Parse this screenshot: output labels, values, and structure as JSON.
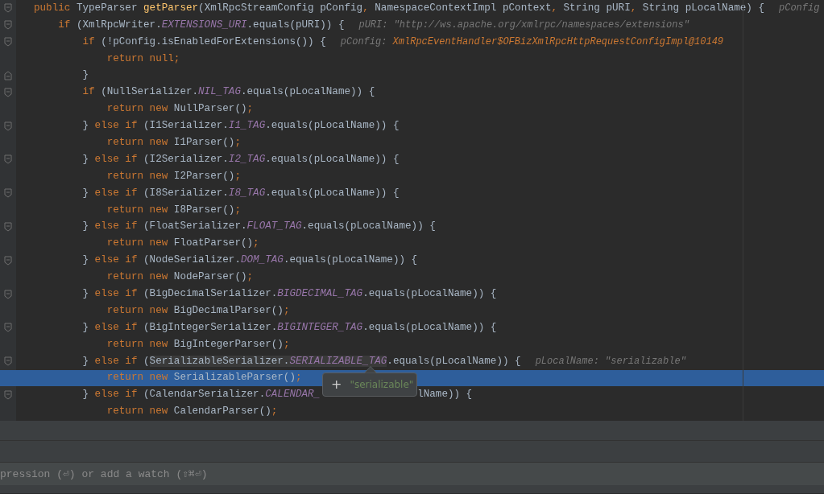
{
  "editor": {
    "lines": [
      {
        "fold_start": true,
        "fold_end": false,
        "selected": false,
        "segments": [
          {
            "kind": "keyword",
            "text": "public "
          },
          {
            "kind": "plain",
            "text": "TypeParser "
          },
          {
            "kind": "method",
            "text": "getParser"
          },
          {
            "kind": "plain",
            "text": "(XmlRpcStreamConfig pConfig"
          },
          {
            "kind": "keyword",
            "text": ", "
          },
          {
            "kind": "plain",
            "text": "NamespaceContextImpl pContext"
          },
          {
            "kind": "keyword",
            "text": ", "
          },
          {
            "kind": "plain",
            "text": "String pURI"
          },
          {
            "kind": "keyword",
            "text": ", "
          },
          {
            "kind": "plain",
            "text": "String pLocalName) {"
          }
        ],
        "hint": [
          {
            "kind": "hint",
            "text": "pConfig"
          }
        ]
      },
      {
        "fold_start": true,
        "fold_end": false,
        "selected": false,
        "segments": [
          {
            "kind": "keyword",
            "text": "    if "
          },
          {
            "kind": "plain",
            "text": "(XmlRpcWriter."
          },
          {
            "kind": "constant",
            "text": "EXTENSIONS_URI"
          },
          {
            "kind": "plain",
            "text": ".equals(pURI)) {"
          }
        ],
        "hint": [
          {
            "kind": "hint",
            "text": "pURI: \"http://ws.apache.org/xmlrpc/namespaces/extensions\""
          }
        ]
      },
      {
        "fold_start": true,
        "fold_end": false,
        "selected": false,
        "segments": [
          {
            "kind": "keyword",
            "text": "        if "
          },
          {
            "kind": "plain",
            "text": "(!pConfig.isEnabledForExtensions()) {"
          }
        ],
        "hint": [
          {
            "kind": "hint",
            "text": "pConfig: "
          },
          {
            "kind": "hint_value",
            "text": "XmlRpcEventHandler$OFBizXmlRpcHttpRequestConfigImpl@10149"
          }
        ]
      },
      {
        "fold_start": false,
        "fold_end": false,
        "selected": false,
        "segments": [
          {
            "kind": "keyword",
            "text": "            return null;"
          }
        ]
      },
      {
        "fold_start": false,
        "fold_end": true,
        "selected": false,
        "segments": [
          {
            "kind": "plain",
            "text": "        }"
          }
        ]
      },
      {
        "fold_start": true,
        "fold_end": false,
        "selected": false,
        "segments": [
          {
            "kind": "keyword",
            "text": "        if "
          },
          {
            "kind": "plain",
            "text": "(NullSerializer."
          },
          {
            "kind": "constant",
            "text": "NIL_TAG"
          },
          {
            "kind": "plain",
            "text": ".equals(pLocalName)) {"
          }
        ]
      },
      {
        "fold_start": false,
        "fold_end": false,
        "selected": false,
        "segments": [
          {
            "kind": "keyword",
            "text": "            return new "
          },
          {
            "kind": "plain",
            "text": "NullParser()"
          },
          {
            "kind": "keyword",
            "text": ";"
          }
        ]
      },
      {
        "fold_start": true,
        "fold_end": false,
        "selected": false,
        "segments": [
          {
            "kind": "plain",
            "text": "        } "
          },
          {
            "kind": "keyword",
            "text": "else if "
          },
          {
            "kind": "plain",
            "text": "(I1Serializer."
          },
          {
            "kind": "constant",
            "text": "I1_TAG"
          },
          {
            "kind": "plain",
            "text": ".equals(pLocalName)) {"
          }
        ]
      },
      {
        "fold_start": false,
        "fold_end": false,
        "selected": false,
        "segments": [
          {
            "kind": "keyword",
            "text": "            return new "
          },
          {
            "kind": "plain",
            "text": "I1Parser()"
          },
          {
            "kind": "keyword",
            "text": ";"
          }
        ]
      },
      {
        "fold_start": true,
        "fold_end": false,
        "selected": false,
        "segments": [
          {
            "kind": "plain",
            "text": "        } "
          },
          {
            "kind": "keyword",
            "text": "else if "
          },
          {
            "kind": "plain",
            "text": "(I2Serializer."
          },
          {
            "kind": "constant",
            "text": "I2_TAG"
          },
          {
            "kind": "plain",
            "text": ".equals(pLocalName)) {"
          }
        ]
      },
      {
        "fold_start": false,
        "fold_end": false,
        "selected": false,
        "segments": [
          {
            "kind": "keyword",
            "text": "            return new "
          },
          {
            "kind": "plain",
            "text": "I2Parser()"
          },
          {
            "kind": "keyword",
            "text": ";"
          }
        ]
      },
      {
        "fold_start": true,
        "fold_end": false,
        "selected": false,
        "segments": [
          {
            "kind": "plain",
            "text": "        } "
          },
          {
            "kind": "keyword",
            "text": "else if "
          },
          {
            "kind": "plain",
            "text": "(I8Serializer."
          },
          {
            "kind": "constant",
            "text": "I8_TAG"
          },
          {
            "kind": "plain",
            "text": ".equals(pLocalName)) {"
          }
        ]
      },
      {
        "fold_start": false,
        "fold_end": false,
        "selected": false,
        "segments": [
          {
            "kind": "keyword",
            "text": "            return new "
          },
          {
            "kind": "plain",
            "text": "I8Parser()"
          },
          {
            "kind": "keyword",
            "text": ";"
          }
        ]
      },
      {
        "fold_start": true,
        "fold_end": false,
        "selected": false,
        "segments": [
          {
            "kind": "plain",
            "text": "        } "
          },
          {
            "kind": "keyword",
            "text": "else if "
          },
          {
            "kind": "plain",
            "text": "(FloatSerializer."
          },
          {
            "kind": "constant",
            "text": "FLOAT_TAG"
          },
          {
            "kind": "plain",
            "text": ".equals(pLocalName)) {"
          }
        ]
      },
      {
        "fold_start": false,
        "fold_end": false,
        "selected": false,
        "segments": [
          {
            "kind": "keyword",
            "text": "            return new "
          },
          {
            "kind": "plain",
            "text": "FloatParser()"
          },
          {
            "kind": "keyword",
            "text": ";"
          }
        ]
      },
      {
        "fold_start": true,
        "fold_end": false,
        "selected": false,
        "segments": [
          {
            "kind": "plain",
            "text": "        } "
          },
          {
            "kind": "keyword",
            "text": "else if "
          },
          {
            "kind": "plain",
            "text": "(NodeSerializer."
          },
          {
            "kind": "constant",
            "text": "DOM_TAG"
          },
          {
            "kind": "plain",
            "text": ".equals(pLocalName)) {"
          }
        ]
      },
      {
        "fold_start": false,
        "fold_end": false,
        "selected": false,
        "segments": [
          {
            "kind": "keyword",
            "text": "            return new "
          },
          {
            "kind": "plain",
            "text": "NodeParser()"
          },
          {
            "kind": "keyword",
            "text": ";"
          }
        ]
      },
      {
        "fold_start": true,
        "fold_end": false,
        "selected": false,
        "segments": [
          {
            "kind": "plain",
            "text": "        } "
          },
          {
            "kind": "keyword",
            "text": "else if "
          },
          {
            "kind": "plain",
            "text": "(BigDecimalSerializer."
          },
          {
            "kind": "constant",
            "text": "BIGDECIMAL_TAG"
          },
          {
            "kind": "plain",
            "text": ".equals(pLocalName)) {"
          }
        ]
      },
      {
        "fold_start": false,
        "fold_end": false,
        "selected": false,
        "segments": [
          {
            "kind": "keyword",
            "text": "            return new "
          },
          {
            "kind": "plain",
            "text": "BigDecimalParser()"
          },
          {
            "kind": "keyword",
            "text": ";"
          }
        ]
      },
      {
        "fold_start": true,
        "fold_end": false,
        "selected": false,
        "segments": [
          {
            "kind": "plain",
            "text": "        } "
          },
          {
            "kind": "keyword",
            "text": "else if "
          },
          {
            "kind": "plain",
            "text": "(BigIntegerSerializer."
          },
          {
            "kind": "constant",
            "text": "BIGINTEGER_TAG"
          },
          {
            "kind": "plain",
            "text": ".equals(pLocalName)) {"
          }
        ]
      },
      {
        "fold_start": false,
        "fold_end": false,
        "selected": false,
        "segments": [
          {
            "kind": "keyword",
            "text": "            return new "
          },
          {
            "kind": "plain",
            "text": "BigIntegerParser()"
          },
          {
            "kind": "keyword",
            "text": ";"
          }
        ]
      },
      {
        "fold_start": true,
        "fold_end": false,
        "selected": false,
        "segments": [
          {
            "kind": "plain",
            "text": "        } "
          },
          {
            "kind": "keyword",
            "text": "else if "
          },
          {
            "kind": "plain",
            "text": "("
          },
          {
            "kind": "plain",
            "text": "SerializableSerializer.",
            "highlighted": true
          },
          {
            "kind": "constant",
            "text": "SERIALIZABLE_TAG",
            "highlighted": true
          },
          {
            "kind": "plain",
            "text": ".equals(pLocalName)) {"
          }
        ],
        "hint": [
          {
            "kind": "hint",
            "text": "pLocalName: \"serializable\""
          }
        ]
      },
      {
        "fold_start": false,
        "fold_end": false,
        "selected": true,
        "segments": [
          {
            "kind": "keyword",
            "text": "            return new "
          },
          {
            "kind": "plain",
            "text": "SerializableParser()"
          },
          {
            "kind": "keyword",
            "text": ";"
          }
        ]
      },
      {
        "fold_start": true,
        "fold_end": false,
        "selected": false,
        "segments": [
          {
            "kind": "plain",
            "text": "        } "
          },
          {
            "kind": "keyword",
            "text": "else if "
          },
          {
            "kind": "plain",
            "text": "(CalendarSerializer."
          },
          {
            "kind": "constant",
            "text": "CALENDAR_"
          },
          {
            "kind": "plain",
            "text": "                lName)) {"
          }
        ]
      },
      {
        "fold_start": false,
        "fold_end": false,
        "selected": false,
        "segments": [
          {
            "kind": "keyword",
            "text": "            return new "
          },
          {
            "kind": "plain",
            "text": "CalendarParser()"
          },
          {
            "kind": "keyword",
            "text": ";"
          }
        ]
      }
    ],
    "tooltip": {
      "expand": "+",
      "value": "\"serializable\""
    }
  },
  "evaluate_field": {
    "placeholder": "pression (⏎) or add a watch (⇧⌘⏎)"
  }
}
